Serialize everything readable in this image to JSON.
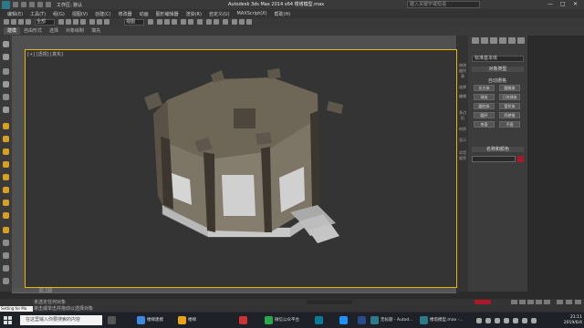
{
  "titlebar": {
    "workspace": "工作区: 默认",
    "title": "Autodesk 3ds Max  2014 x64      楼塔模型.max",
    "search_placeholder": "键入关键字或短语",
    "minimize": "—",
    "maximize": "□",
    "close": "✕"
  },
  "menubar": {
    "items": [
      "编辑(E)",
      "工具(T)",
      "组(G)",
      "视图(V)",
      "创建(C)",
      "修改器",
      "动画",
      "图形编辑器",
      "渲染(R)",
      "自定义(U)",
      "MAXScript(X)",
      "帮助(H)"
    ]
  },
  "toolbar": {
    "filter_value": "全部",
    "view_value": "视图"
  },
  "ribbon": {
    "tabs": [
      "建模",
      "自由形式",
      "选择",
      "对象绘制",
      "填充"
    ],
    "active_index": 0
  },
  "viewport": {
    "label": "[+] [透视] [真实]",
    "border_color": "#e6b800"
  },
  "command_panel": {
    "dropdown_value": "标准基本体",
    "object_type_header": "对象类型",
    "autogrid_label": "自动栅格",
    "object_buttons": [
      "长方体",
      "圆锥体",
      "球体",
      "几何球体",
      "圆柱体",
      "管状体",
      "圆环",
      "四棱锥",
      "茶壶",
      "平面"
    ],
    "name_color_header": "名称和颜色",
    "side_tabs": [
      "修改器列表",
      "选择",
      "编辑",
      "多边形",
      "材质",
      "显示",
      "实用程序"
    ]
  },
  "timeline": {
    "slider_label": "0 / 100"
  },
  "statusbar": {
    "line1": "未选定任何对象",
    "line2": "单击或单击并拖动以选择对象",
    "maxscript_label": "Setting for Ma"
  },
  "taskbar": {
    "search_placeholder": "在这里输入你要搜索的内容",
    "apps": [
      "楼梯建模",
      "楼梯",
      "微信公众平台",
      "无标题 - Autod...",
      "楼塔模型.max -..."
    ],
    "time": "21:11",
    "date": "2019/6/4"
  }
}
